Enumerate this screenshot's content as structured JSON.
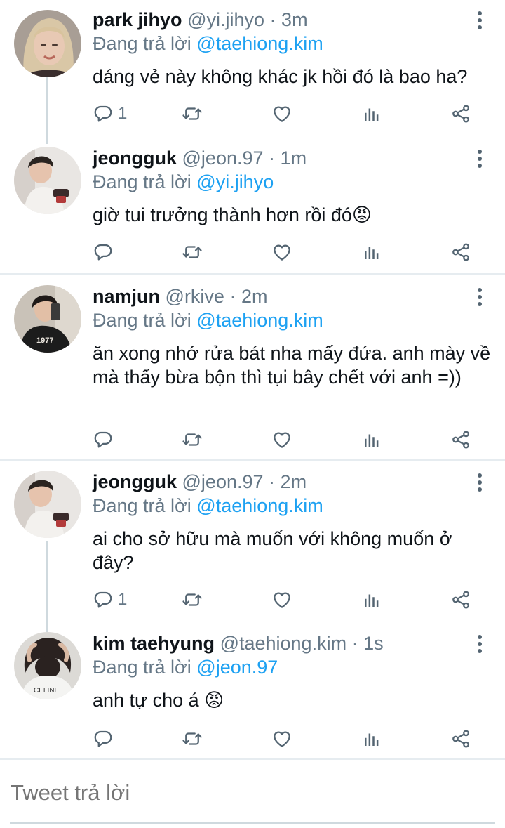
{
  "tweets": [
    {
      "name": "park jihyo",
      "handle": "@yi.jihyo",
      "dot": "·",
      "time": "3m",
      "reply_prefix": "Đang trả lời",
      "reply_to": "@taehiong.kim",
      "text": "dáng vẻ này không khác jk hồi đó là bao ha?",
      "reply_count": "1"
    },
    {
      "name": "jeongguk",
      "handle": "@jeon.97",
      "dot": "·",
      "time": "1m",
      "reply_prefix": "Đang trả lời",
      "reply_to": "@yi.jihyo",
      "text": "giờ tui trưởng thành hơn rồi đó😡",
      "reply_count": ""
    },
    {
      "name": "namjun",
      "handle": "@rkive",
      "dot": "·",
      "time": "2m",
      "reply_prefix": "Đang trả lời",
      "reply_to": "@taehiong.kim",
      "text": "ăn xong nhớ rửa bát nha mấy đứa. anh mày về mà thấy bừa bộn thì tụi bây chết với anh =))",
      "reply_count": "",
      "avatar_shirt_text": "1977"
    },
    {
      "name": "jeongguk",
      "handle": "@jeon.97",
      "dot": "·",
      "time": "2m",
      "reply_prefix": "Đang trả lời",
      "reply_to": "@taehiong.kim",
      "text": "ai cho sở hữu mà muốn với không muốn ở đây?",
      "reply_count": "1"
    },
    {
      "name": "kim taehyung",
      "handle": "@taehiong.kim",
      "dot": "·",
      "time": "1s",
      "reply_prefix": "Đang trả lời",
      "reply_to": "@jeon.97",
      "text": "anh tự cho á 😡",
      "reply_count": "",
      "avatar_shirt_text": "CELINE"
    }
  ],
  "compose": {
    "placeholder": "Tweet trả lời"
  },
  "colors": {
    "link": "#1da1f2",
    "muted": "#657786",
    "text": "#0f1419",
    "divider": "#e6ecf0",
    "thread_line": "#cfd9de"
  },
  "icons": [
    "reply-icon",
    "retweet-icon",
    "like-icon",
    "stats-icon",
    "share-icon",
    "more-icon"
  ]
}
